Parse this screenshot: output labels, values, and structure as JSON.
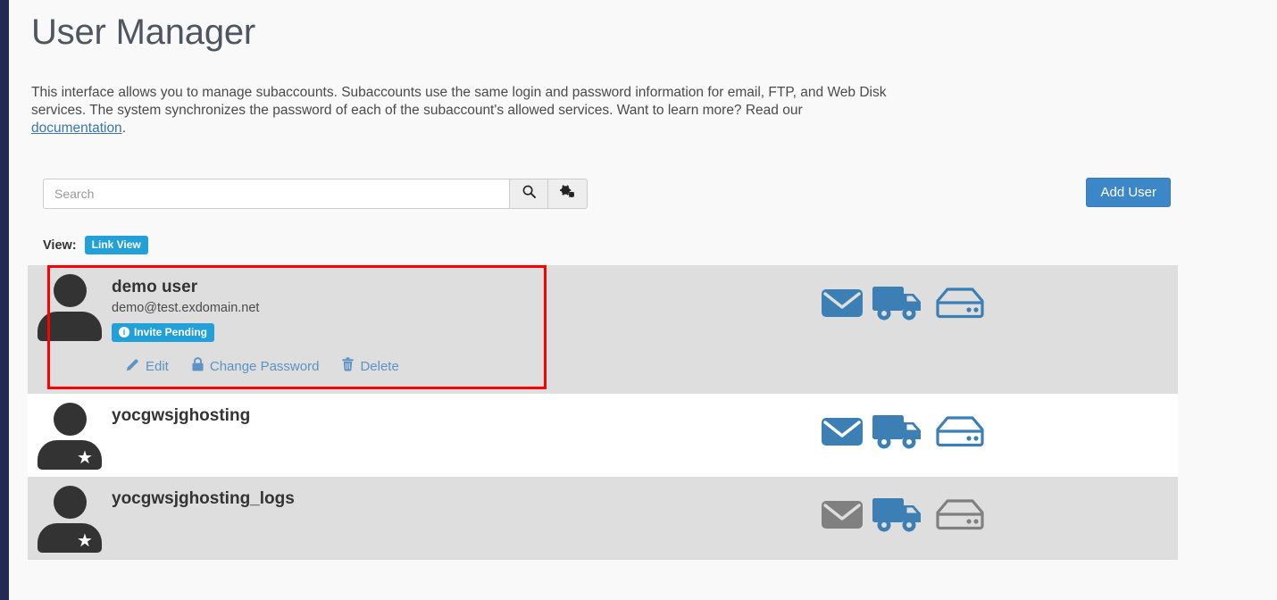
{
  "theme": {
    "rail_color": "#222a52",
    "page_bg": "#f9f9f9",
    "accent_blue": "#3b87c8",
    "badge_blue": "#22a0d8",
    "link_blue": "#5b93c4",
    "row_striped_bg": "#dedede",
    "row_plain_bg": "#ffffff",
    "highlight_border": "#ff0000",
    "service_enabled": "#3b7fb5",
    "service_disabled": "#808080"
  },
  "header": {
    "title": "User Manager",
    "description_part1": "This interface allows you to manage subaccounts. Subaccounts use the same login and password information for email, FTP, and Web Disk services. The system synchronizes the password of each of the subaccount's allowed services. Want to learn more? Read our ",
    "documentation_link": "documentation",
    "description_part2": "."
  },
  "toolbar": {
    "search_value": "",
    "search_placeholder": "Search",
    "search_button_icon": "search-icon",
    "settings_button_icon": "cogs-icon",
    "add_user_label": "Add User"
  },
  "view": {
    "label": "View:",
    "active_mode": "Link View"
  },
  "users": [
    {
      "name": "demo user",
      "email": "demo@test.exdomain.net",
      "status_badge": "Invite Pending",
      "status_icon": "info-circle-icon",
      "has_star": false,
      "striped": true,
      "highlighted": true,
      "actions": [
        {
          "label": "Edit",
          "icon": "pencil-icon"
        },
        {
          "label": "Change Password",
          "icon": "lock-icon"
        },
        {
          "label": "Delete",
          "icon": "trash-icon"
        }
      ],
      "services": [
        {
          "name": "email",
          "icon": "envelope-icon",
          "enabled": true
        },
        {
          "name": "ftp",
          "icon": "truck-icon",
          "enabled": true
        },
        {
          "name": "webdisk",
          "icon": "hard-drive-icon",
          "enabled": true
        }
      ]
    },
    {
      "name": "yocgwsjghosting",
      "email": "",
      "status_badge": "",
      "has_star": true,
      "striped": false,
      "highlighted": false,
      "actions": [],
      "services": [
        {
          "name": "email",
          "icon": "envelope-icon",
          "enabled": true
        },
        {
          "name": "ftp",
          "icon": "truck-icon",
          "enabled": true
        },
        {
          "name": "webdisk",
          "icon": "hard-drive-icon",
          "enabled": true
        }
      ]
    },
    {
      "name": "yocgwsjghosting_logs",
      "email": "",
      "status_badge": "",
      "has_star": true,
      "striped": true,
      "highlighted": false,
      "actions": [],
      "services": [
        {
          "name": "email",
          "icon": "envelope-icon",
          "enabled": false
        },
        {
          "name": "ftp",
          "icon": "truck-icon",
          "enabled": true
        },
        {
          "name": "webdisk",
          "icon": "hard-drive-icon",
          "enabled": false
        }
      ]
    }
  ]
}
